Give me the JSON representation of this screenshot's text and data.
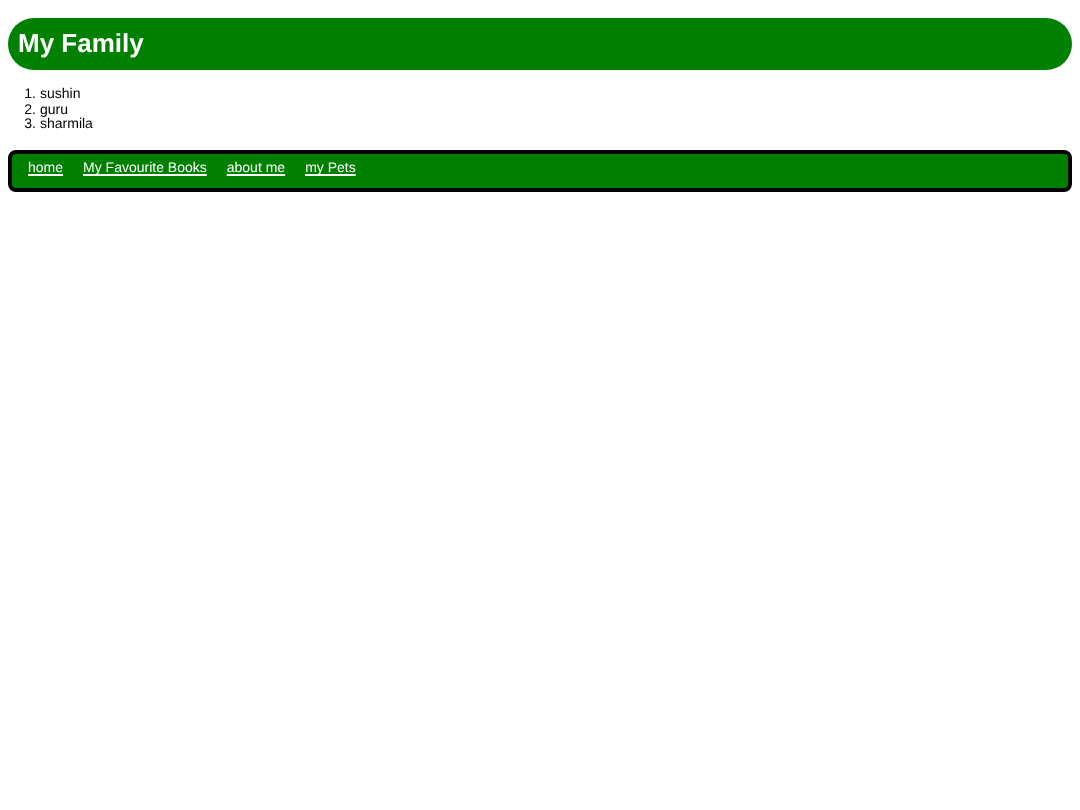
{
  "header": {
    "title": "My Family"
  },
  "family_list": [
    {
      "number": "1.",
      "name": "sushin"
    },
    {
      "number": "2.",
      "name": "guru"
    },
    {
      "number": "3.",
      "name": "sharmila"
    }
  ],
  "nav_links": [
    {
      "label": "home"
    },
    {
      "label": "My Favourite Books"
    },
    {
      "label": "about me"
    },
    {
      "label": "my Pets"
    }
  ]
}
